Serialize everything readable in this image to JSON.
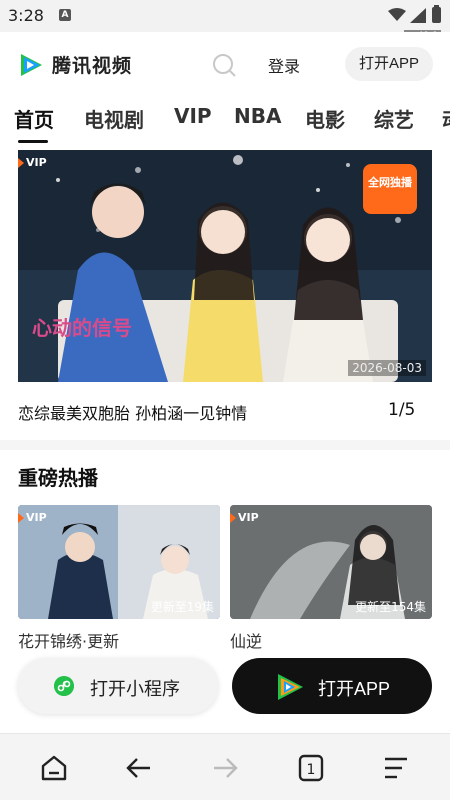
{
  "status_bar": {
    "time": "3:28",
    "app_badge": "A"
  },
  "build_tag": "cu49-1",
  "header": {
    "brand": "腾讯视频",
    "login_label": "登录",
    "open_app_label": "打开APP"
  },
  "tabs": [
    "首页",
    "电视剧",
    "VIP",
    "NBA",
    "电影",
    "综艺",
    "动"
  ],
  "active_tab": "首页",
  "banner": {
    "vip_label": "VIP",
    "date": "2026-08-03",
    "caption": "恋综最美双胞胎 孙柏涵一见钟情",
    "pager": "1/5",
    "poster_text": "心动的信号",
    "badge_text": "全网独播"
  },
  "section": {
    "title": "重磅热播",
    "cards": [
      {
        "vip_label": "VIP",
        "update": "更新至19集",
        "title": "花开锦绣·更新",
        "subtitle": ""
      },
      {
        "vip_label": "VIP",
        "update": "更新至154集",
        "title": "仙逆",
        "subtitle": ""
      }
    ]
  },
  "floating_buttons": {
    "mini_program": "打开小程序",
    "open_app": "打开APP"
  },
  "nav_icons": [
    "home-icon",
    "back-arrow-icon",
    "forward-arrow-icon",
    "tabs-count-icon",
    "menu-icon"
  ],
  "nav": {
    "tabs_count": "1"
  },
  "colors": {
    "accent": "#ff6a1a",
    "brand_blue": "#1aa0ff",
    "brand_green": "#23c14a",
    "dark_button": "#111111"
  }
}
